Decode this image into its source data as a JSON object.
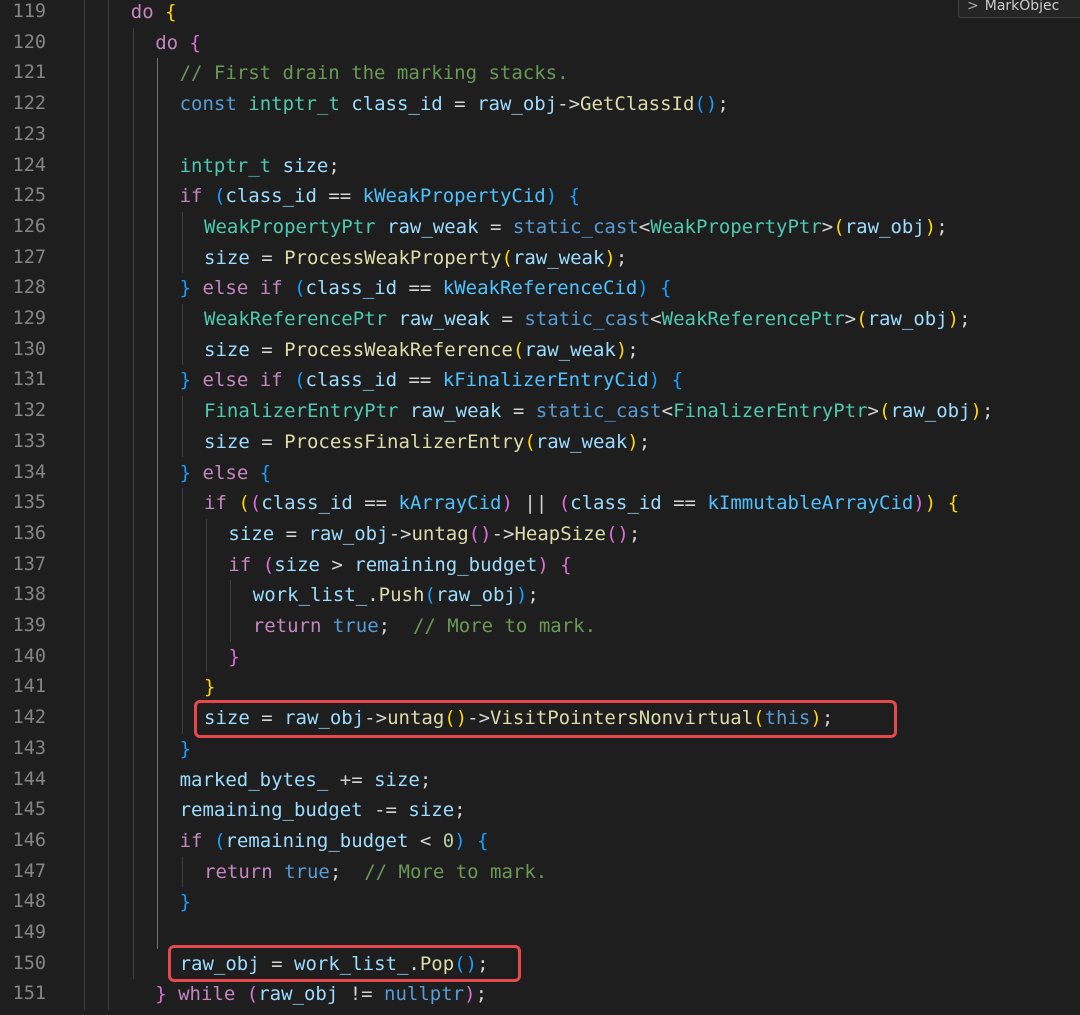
{
  "editor": {
    "widget": {
      "icon": "chevron-right-icon",
      "label": "MarkObjec"
    },
    "highlights": [
      "line-142",
      "line-150"
    ],
    "lines": [
      {
        "n": "119",
        "indent": "    ",
        "tokens": [
          [
            "kw",
            "do"
          ],
          [
            "op",
            " "
          ],
          [
            "b1",
            "{"
          ]
        ]
      },
      {
        "n": "120",
        "indent": "      ",
        "tokens": [
          [
            "kw",
            "do"
          ],
          [
            "op",
            " "
          ],
          [
            "b2",
            "{"
          ]
        ]
      },
      {
        "n": "121",
        "indent": "        ",
        "tokens": [
          [
            "cm",
            "// First drain the marking stacks."
          ]
        ]
      },
      {
        "n": "122",
        "indent": "        ",
        "tokens": [
          [
            "kwb",
            "const"
          ],
          [
            "op",
            " "
          ],
          [
            "ty",
            "intptr_t"
          ],
          [
            "op",
            " "
          ],
          [
            "var",
            "class_id"
          ],
          [
            "op",
            " = "
          ],
          [
            "var",
            "raw_obj"
          ],
          [
            "op",
            "->"
          ],
          [
            "fn",
            "GetClassId"
          ],
          [
            "b3",
            "()"
          ],
          [
            "op",
            ";"
          ]
        ]
      },
      {
        "n": "123",
        "indent": "",
        "tokens": []
      },
      {
        "n": "124",
        "indent": "        ",
        "tokens": [
          [
            "ty",
            "intptr_t"
          ],
          [
            "op",
            " "
          ],
          [
            "var",
            "size"
          ],
          [
            "op",
            ";"
          ]
        ]
      },
      {
        "n": "125",
        "indent": "        ",
        "tokens": [
          [
            "kw",
            "if"
          ],
          [
            "op",
            " "
          ],
          [
            "b3",
            "("
          ],
          [
            "var",
            "class_id"
          ],
          [
            "op",
            " == "
          ],
          [
            "cst",
            "kWeakPropertyCid"
          ],
          [
            "b3",
            ")"
          ],
          [
            "op",
            " "
          ],
          [
            "b3",
            "{"
          ]
        ]
      },
      {
        "n": "126",
        "indent": "          ",
        "tokens": [
          [
            "ty",
            "WeakPropertyPtr"
          ],
          [
            "op",
            " "
          ],
          [
            "var",
            "raw_weak"
          ],
          [
            "op",
            " = "
          ],
          [
            "kwb",
            "static_cast"
          ],
          [
            "op",
            "<"
          ],
          [
            "ty",
            "WeakPropertyPtr"
          ],
          [
            "op",
            ">"
          ],
          [
            "b1",
            "("
          ],
          [
            "var",
            "raw_obj"
          ],
          [
            "b1",
            ")"
          ],
          [
            "op",
            ";"
          ]
        ]
      },
      {
        "n": "127",
        "indent": "          ",
        "tokens": [
          [
            "var",
            "size"
          ],
          [
            "op",
            " = "
          ],
          [
            "fn",
            "ProcessWeakProperty"
          ],
          [
            "b1",
            "("
          ],
          [
            "var",
            "raw_weak"
          ],
          [
            "b1",
            ")"
          ],
          [
            "op",
            ";"
          ]
        ]
      },
      {
        "n": "128",
        "indent": "        ",
        "tokens": [
          [
            "b3",
            "}"
          ],
          [
            "op",
            " "
          ],
          [
            "kw",
            "else"
          ],
          [
            "op",
            " "
          ],
          [
            "kw",
            "if"
          ],
          [
            "op",
            " "
          ],
          [
            "b3",
            "("
          ],
          [
            "var",
            "class_id"
          ],
          [
            "op",
            " == "
          ],
          [
            "cst",
            "kWeakReferenceCid"
          ],
          [
            "b3",
            ")"
          ],
          [
            "op",
            " "
          ],
          [
            "b3",
            "{"
          ]
        ]
      },
      {
        "n": "129",
        "indent": "          ",
        "tokens": [
          [
            "ty",
            "WeakReferencePtr"
          ],
          [
            "op",
            " "
          ],
          [
            "var",
            "raw_weak"
          ],
          [
            "op",
            " = "
          ],
          [
            "kwb",
            "static_cast"
          ],
          [
            "op",
            "<"
          ],
          [
            "ty",
            "WeakReferencePtr"
          ],
          [
            "op",
            ">"
          ],
          [
            "b1",
            "("
          ],
          [
            "var",
            "raw_obj"
          ],
          [
            "b1",
            ")"
          ],
          [
            "op",
            ";"
          ]
        ]
      },
      {
        "n": "130",
        "indent": "          ",
        "tokens": [
          [
            "var",
            "size"
          ],
          [
            "op",
            " = "
          ],
          [
            "fn",
            "ProcessWeakReference"
          ],
          [
            "b1",
            "("
          ],
          [
            "var",
            "raw_weak"
          ],
          [
            "b1",
            ")"
          ],
          [
            "op",
            ";"
          ]
        ]
      },
      {
        "n": "131",
        "indent": "        ",
        "tokens": [
          [
            "b3",
            "}"
          ],
          [
            "op",
            " "
          ],
          [
            "kw",
            "else"
          ],
          [
            "op",
            " "
          ],
          [
            "kw",
            "if"
          ],
          [
            "op",
            " "
          ],
          [
            "b3",
            "("
          ],
          [
            "var",
            "class_id"
          ],
          [
            "op",
            " == "
          ],
          [
            "cst",
            "kFinalizerEntryCid"
          ],
          [
            "b3",
            ")"
          ],
          [
            "op",
            " "
          ],
          [
            "b3",
            "{"
          ]
        ]
      },
      {
        "n": "132",
        "indent": "          ",
        "tokens": [
          [
            "ty",
            "FinalizerEntryPtr"
          ],
          [
            "op",
            " "
          ],
          [
            "var",
            "raw_weak"
          ],
          [
            "op",
            " = "
          ],
          [
            "kwb",
            "static_cast"
          ],
          [
            "op",
            "<"
          ],
          [
            "ty",
            "FinalizerEntryPtr"
          ],
          [
            "op",
            ">"
          ],
          [
            "b1",
            "("
          ],
          [
            "var",
            "raw_obj"
          ],
          [
            "b1",
            ")"
          ],
          [
            "op",
            ";"
          ]
        ]
      },
      {
        "n": "133",
        "indent": "          ",
        "tokens": [
          [
            "var",
            "size"
          ],
          [
            "op",
            " = "
          ],
          [
            "fn",
            "ProcessFinalizerEntry"
          ],
          [
            "b1",
            "("
          ],
          [
            "var",
            "raw_weak"
          ],
          [
            "b1",
            ")"
          ],
          [
            "op",
            ";"
          ]
        ]
      },
      {
        "n": "134",
        "indent": "        ",
        "tokens": [
          [
            "b3",
            "}"
          ],
          [
            "op",
            " "
          ],
          [
            "kw",
            "else"
          ],
          [
            "op",
            " "
          ],
          [
            "b3",
            "{"
          ]
        ]
      },
      {
        "n": "135",
        "indent": "          ",
        "tokens": [
          [
            "kw",
            "if"
          ],
          [
            "op",
            " "
          ],
          [
            "b1",
            "("
          ],
          [
            "b2",
            "("
          ],
          [
            "var",
            "class_id"
          ],
          [
            "op",
            " == "
          ],
          [
            "cst",
            "kArrayCid"
          ],
          [
            "b2",
            ")"
          ],
          [
            "op",
            " || "
          ],
          [
            "b2",
            "("
          ],
          [
            "var",
            "class_id"
          ],
          [
            "op",
            " == "
          ],
          [
            "cst",
            "kImmutableArrayCid"
          ],
          [
            "b2",
            ")"
          ],
          [
            "b1",
            ")"
          ],
          [
            "op",
            " "
          ],
          [
            "b1",
            "{"
          ]
        ]
      },
      {
        "n": "136",
        "indent": "            ",
        "tokens": [
          [
            "var",
            "size"
          ],
          [
            "op",
            " = "
          ],
          [
            "var",
            "raw_obj"
          ],
          [
            "op",
            "->"
          ],
          [
            "fn",
            "untag"
          ],
          [
            "b2",
            "()"
          ],
          [
            "op",
            "->"
          ],
          [
            "fn",
            "HeapSize"
          ],
          [
            "b2",
            "()"
          ],
          [
            "op",
            ";"
          ]
        ]
      },
      {
        "n": "137",
        "indent": "            ",
        "tokens": [
          [
            "kw",
            "if"
          ],
          [
            "op",
            " "
          ],
          [
            "b2",
            "("
          ],
          [
            "var",
            "size"
          ],
          [
            "op",
            " > "
          ],
          [
            "var",
            "remaining_budget"
          ],
          [
            "b2",
            ")"
          ],
          [
            "op",
            " "
          ],
          [
            "b2",
            "{"
          ]
        ]
      },
      {
        "n": "138",
        "indent": "              ",
        "tokens": [
          [
            "var",
            "work_list_"
          ],
          [
            "op",
            "."
          ],
          [
            "fn",
            "Push"
          ],
          [
            "b3",
            "("
          ],
          [
            "var",
            "raw_obj"
          ],
          [
            "b3",
            ")"
          ],
          [
            "op",
            ";"
          ]
        ]
      },
      {
        "n": "139",
        "indent": "              ",
        "tokens": [
          [
            "kw",
            "return"
          ],
          [
            "op",
            " "
          ],
          [
            "kwb",
            "true"
          ],
          [
            "op",
            ";  "
          ],
          [
            "cm",
            "// More to mark."
          ]
        ]
      },
      {
        "n": "140",
        "indent": "            ",
        "tokens": [
          [
            "b2",
            "}"
          ]
        ]
      },
      {
        "n": "141",
        "indent": "          ",
        "tokens": [
          [
            "b1",
            "}"
          ]
        ]
      },
      {
        "n": "142",
        "indent": "          ",
        "tokens": [
          [
            "var",
            "size"
          ],
          [
            "op",
            " = "
          ],
          [
            "var",
            "raw_obj"
          ],
          [
            "op",
            "->"
          ],
          [
            "fn",
            "untag"
          ],
          [
            "b1",
            "()"
          ],
          [
            "op",
            "->"
          ],
          [
            "fn",
            "VisitPointersNonvirtual"
          ],
          [
            "b1",
            "("
          ],
          [
            "kwb",
            "this"
          ],
          [
            "b1",
            ")"
          ],
          [
            "op",
            ";"
          ]
        ]
      },
      {
        "n": "143",
        "indent": "        ",
        "tokens": [
          [
            "b3",
            "}"
          ]
        ]
      },
      {
        "n": "144",
        "indent": "        ",
        "tokens": [
          [
            "var",
            "marked_bytes_"
          ],
          [
            "op",
            " += "
          ],
          [
            "var",
            "size"
          ],
          [
            "op",
            ";"
          ]
        ]
      },
      {
        "n": "145",
        "indent": "        ",
        "tokens": [
          [
            "var",
            "remaining_budget"
          ],
          [
            "op",
            " -= "
          ],
          [
            "var",
            "size"
          ],
          [
            "op",
            ";"
          ]
        ]
      },
      {
        "n": "146",
        "indent": "        ",
        "tokens": [
          [
            "kw",
            "if"
          ],
          [
            "op",
            " "
          ],
          [
            "b3",
            "("
          ],
          [
            "var",
            "remaining_budget"
          ],
          [
            "op",
            " < "
          ],
          [
            "num",
            "0"
          ],
          [
            "b3",
            ")"
          ],
          [
            "op",
            " "
          ],
          [
            "b3",
            "{"
          ]
        ]
      },
      {
        "n": "147",
        "indent": "          ",
        "tokens": [
          [
            "kw",
            "return"
          ],
          [
            "op",
            " "
          ],
          [
            "kwb",
            "true"
          ],
          [
            "op",
            ";  "
          ],
          [
            "cm",
            "// More to mark."
          ]
        ]
      },
      {
        "n": "148",
        "indent": "        ",
        "tokens": [
          [
            "b3",
            "}"
          ]
        ]
      },
      {
        "n": "149",
        "indent": "",
        "tokens": []
      },
      {
        "n": "150",
        "indent": "        ",
        "tokens": [
          [
            "var",
            "raw_obj"
          ],
          [
            "op",
            " = "
          ],
          [
            "var",
            "work_list_"
          ],
          [
            "op",
            "."
          ],
          [
            "fn",
            "Pop"
          ],
          [
            "b3",
            "()"
          ],
          [
            "op",
            ";"
          ]
        ]
      },
      {
        "n": "151",
        "indent": "      ",
        "tokens": [
          [
            "b2",
            "}"
          ],
          [
            "op",
            " "
          ],
          [
            "kw",
            "while"
          ],
          [
            "op",
            " "
          ],
          [
            "b2",
            "("
          ],
          [
            "var",
            "raw_obj"
          ],
          [
            "op",
            " != "
          ],
          [
            "kwb",
            "nullptr"
          ],
          [
            "b2",
            ")"
          ],
          [
            "op",
            ";"
          ]
        ]
      }
    ]
  }
}
